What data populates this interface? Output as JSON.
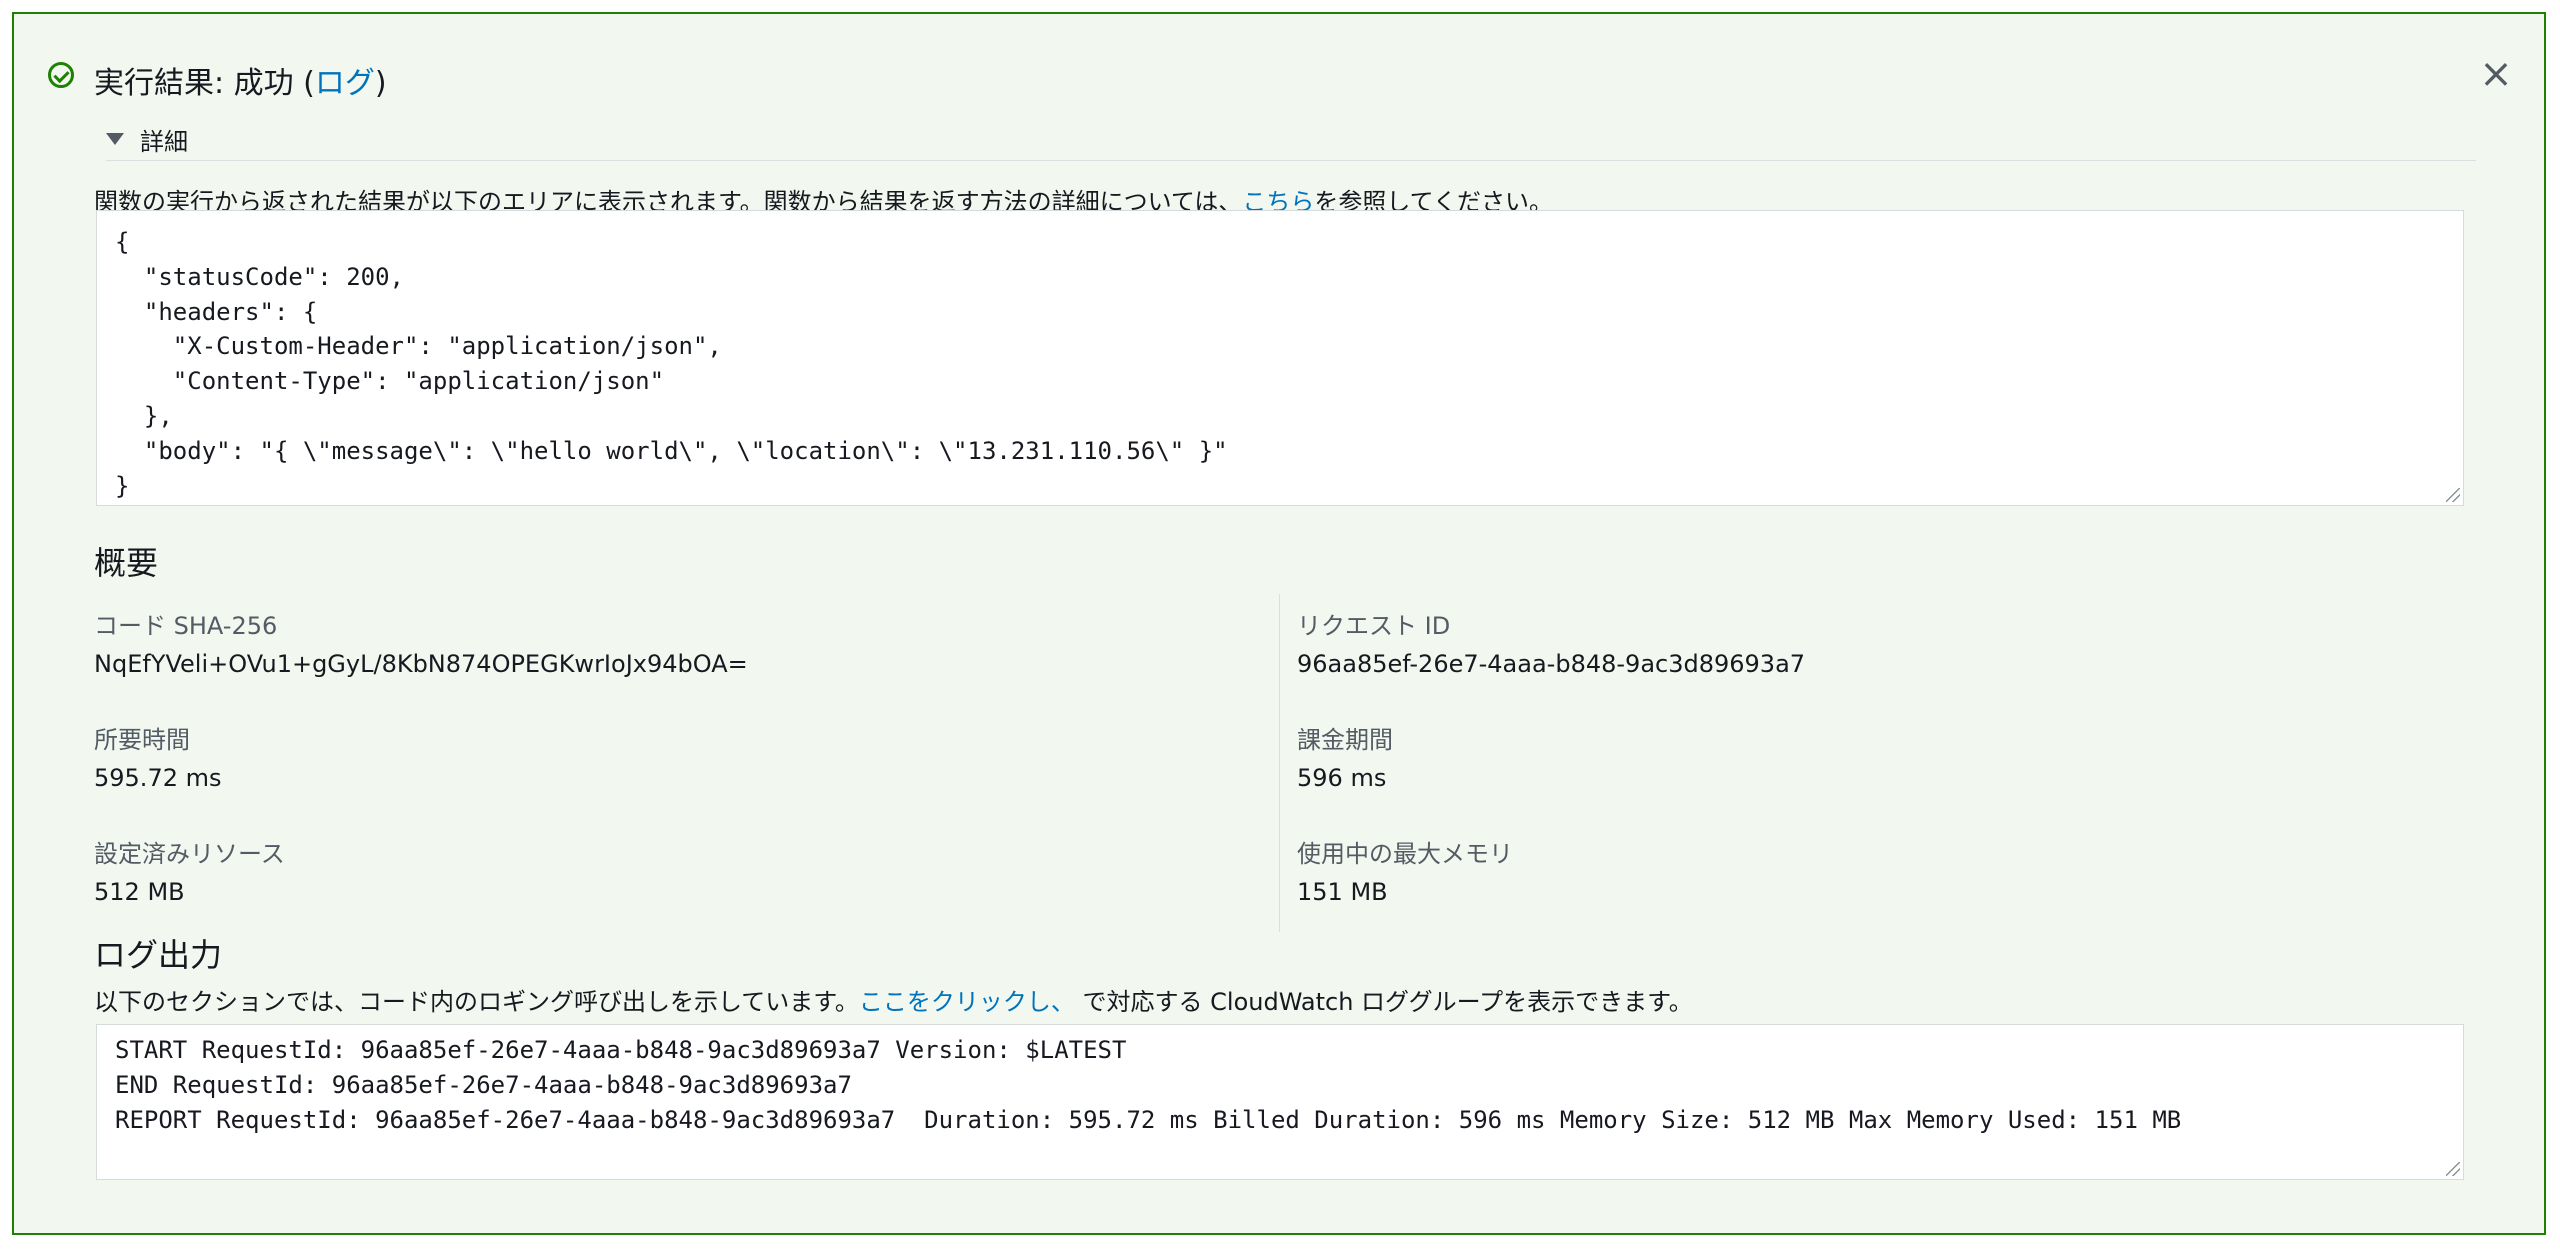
{
  "header": {
    "title_prefix": "実行結果: 成功 (",
    "title_link": "ログ",
    "title_suffix": ")",
    "close_label": "×"
  },
  "details": {
    "label": "詳細",
    "description_prefix": "関数の実行から返された結果が以下のエリアに表示されます。関数から結果を返す方法の詳細については、",
    "description_link": "こちら",
    "description_suffix": "を参照してください。",
    "result_json": "{\n  \"statusCode\": 200,\n  \"headers\": {\n    \"X-Custom-Header\": \"application/json\",\n    \"Content-Type\": \"application/json\"\n  },\n  \"body\": \"{ \\\"message\\\": \\\"hello world\\\", \\\"location\\\": \\\"13.231.110.56\\\" }\"\n}"
  },
  "summary": {
    "title": "概要",
    "left": [
      {
        "label": "コード SHA-256",
        "value": "NqEfYVeli+OVu1+gGyL/8KbN874OPEGKwrIoJx94bOA="
      },
      {
        "label": "所要時間",
        "value": "595.72 ms"
      },
      {
        "label": "設定済みリソース",
        "value": "512 MB"
      }
    ],
    "right": [
      {
        "label": "リクエスト ID",
        "value": "96aa85ef-26e7-4aaa-b848-9ac3d89693a7"
      },
      {
        "label": "課金期間",
        "value": "596 ms"
      },
      {
        "label": "使用中の最大メモリ",
        "value": "151 MB"
      }
    ]
  },
  "log_output": {
    "title": "ログ出力",
    "description_prefix": "以下のセクションでは、コード内のロギング呼び出しを示しています。",
    "description_link": "ここをクリックし、",
    "description_suffix": " で対応する CloudWatch ロググループを表示できます。",
    "log_text": "START RequestId: 96aa85ef-26e7-4aaa-b848-9ac3d89693a7 Version: $LATEST\nEND RequestId: 96aa85ef-26e7-4aaa-b848-9ac3d89693a7\nREPORT RequestId: 96aa85ef-26e7-4aaa-b848-9ac3d89693a7\tDuration: 595.72 ms\tBilled Duration: 596 ms\tMemory Size: 512 MB\tMax Memory Used: 151 MB"
  },
  "colors": {
    "success": "#1d8102",
    "panel_bg": "#f2f8f0",
    "link": "#0073bb"
  },
  "icons": {
    "status": "check-circle-icon",
    "close": "close-icon",
    "expand": "caret-down-icon"
  }
}
